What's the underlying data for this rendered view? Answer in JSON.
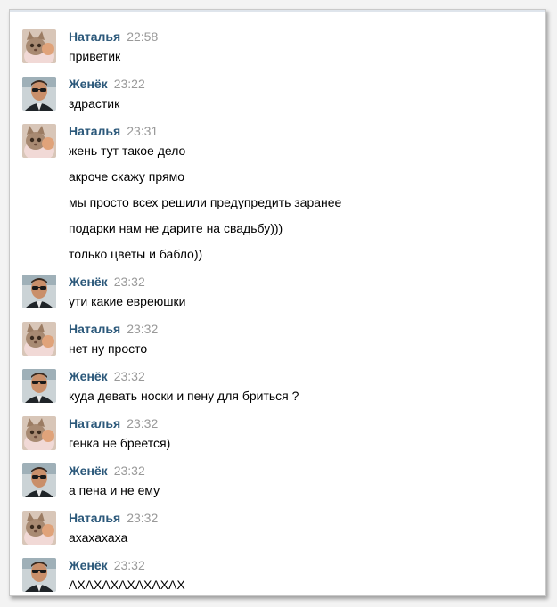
{
  "messages": [
    {
      "author": "Наталья",
      "time": "22:58",
      "avatar": "cat-avatar",
      "lines": [
        "приветик"
      ]
    },
    {
      "author": "Женёк",
      "time": "23:22",
      "avatar": "man-sunglasses-avatar",
      "lines": [
        "здрастик"
      ]
    },
    {
      "author": "Наталья",
      "time": "23:31",
      "avatar": "cat-avatar",
      "lines": [
        "жень тут такое дело",
        "акроче скажу прямо",
        "мы просто всех решили предупредить заранее",
        "подарки нам не дарите на свадьбу)))",
        "только цветы и бабло))"
      ]
    },
    {
      "author": "Женёк",
      "time": "23:32",
      "avatar": "man-sunglasses-avatar",
      "lines": [
        "ути какие евреюшки"
      ]
    },
    {
      "author": "Наталья",
      "time": "23:32",
      "avatar": "cat-avatar",
      "lines": [
        "нет ну просто"
      ]
    },
    {
      "author": "Женёк",
      "time": "23:32",
      "avatar": "man-sunglasses-avatar",
      "lines": [
        "куда девать носки и пену для бриться ?"
      ]
    },
    {
      "author": "Наталья",
      "time": "23:32",
      "avatar": "cat-avatar",
      "lines": [
        "генка не бреется)"
      ]
    },
    {
      "author": "Женёк",
      "time": "23:32",
      "avatar": "man-sunglasses-avatar",
      "lines": [
        "а пена и не ему"
      ]
    },
    {
      "author": "Наталья",
      "time": "23:32",
      "avatar": "cat-avatar",
      "lines": [
        "ахахахаха"
      ]
    },
    {
      "author": "Женёк",
      "time": "23:32",
      "avatar": "man-sunglasses-avatar",
      "lines": [
        "АХАХАХАХАХАХАХ"
      ]
    }
  ],
  "colors": {
    "author": "#2b587a",
    "time": "#999999",
    "text": "#000000",
    "frame_border": "#c9c9c9"
  }
}
